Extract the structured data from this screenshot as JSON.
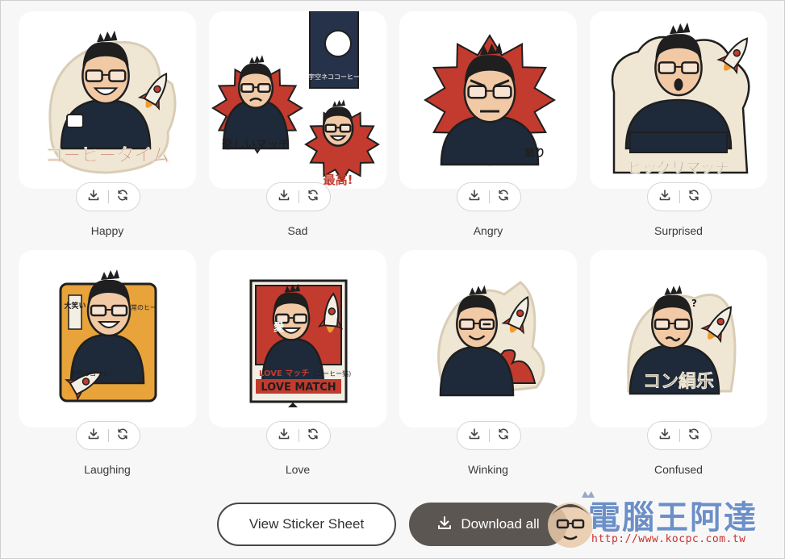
{
  "stickers": [
    {
      "label": "Happy",
      "caption": "コーヒータイム",
      "bg": "#efe6d4",
      "burst": false,
      "accent": "#c23b2e"
    },
    {
      "label": "Sad",
      "caption": "悲しいマッチ",
      "caption2": "最高!",
      "caption3": "宇空ネココーヒー",
      "bg": "#efe6d4",
      "burst": true,
      "accent": "#c23b2e"
    },
    {
      "label": "Angry",
      "caption": "怒り",
      "bg": "#c23b2e",
      "burst": true,
      "accent": "#c23b2e"
    },
    {
      "label": "Surprised",
      "caption": "ビッグリマッチ",
      "bg": "#efe6d4",
      "burst": false,
      "accent": "#c23b2e"
    },
    {
      "label": "Laughing",
      "caption": "宇空のコーヒー",
      "caption2": "大笑い",
      "caption3": "常のヒー",
      "bg": "#e8a33a",
      "burst": false,
      "accent": "#c23b2e"
    },
    {
      "label": "Love",
      "caption": "LOVE MATCH",
      "caption2": "LOVE マッチ",
      "caption3": "(コーヒー猫)",
      "caption4": "愛",
      "bg": "#c23b2e",
      "burst": false,
      "accent": "#c23b2e"
    },
    {
      "label": "Winking",
      "caption": "",
      "bg": "#efe6d4",
      "burst": false,
      "accent": "#c23b2e"
    },
    {
      "label": "Confused",
      "caption": "コン絹乐",
      "bg": "#efe6d4",
      "burst": false,
      "accent": "#c23b2e"
    }
  ],
  "buttons": {
    "view_sheet": "View Sticker Sheet",
    "download_all": "Download all"
  },
  "watermark": {
    "text": "電腦王阿達",
    "url": "http://www.kocpc.com.tw"
  },
  "colors": {
    "card_bg": "#ffffff",
    "page_bg": "#f7f7f7",
    "button_dark": "#5b5652",
    "sticker_red": "#c23b2e",
    "sticker_cream": "#efe6d4",
    "ink": "#1f1f1f"
  }
}
